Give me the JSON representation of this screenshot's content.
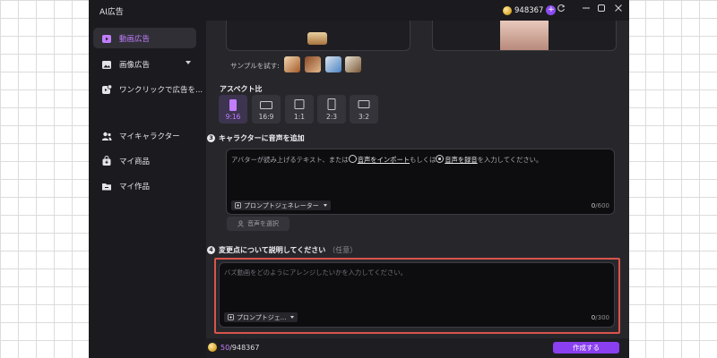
{
  "window": {
    "title": "AI広告",
    "credits": "948367",
    "controls": [
      "refresh-icon",
      "minimize-icon",
      "maximize-icon",
      "close-icon"
    ]
  },
  "sidebar": {
    "items": [
      {
        "label": "動画広告",
        "icon": "video-ad-icon",
        "active": true
      },
      {
        "label": "画像広告",
        "icon": "image-ad-icon",
        "active": false,
        "expandable": true
      },
      {
        "label": "ワンクリックで広告を...",
        "icon": "add-video-icon",
        "active": false
      },
      {
        "label": "マイキャラクター",
        "icon": "characters-icon",
        "active": false
      },
      {
        "label": "マイ商品",
        "icon": "products-icon",
        "active": false
      },
      {
        "label": "マイ作品",
        "icon": "folder-icon",
        "active": false
      }
    ]
  },
  "samples": {
    "label": "サンプルを試す:"
  },
  "aspect": {
    "title": "アスペクト比",
    "selected": "9:16",
    "options": [
      "9:16",
      "16:9",
      "1:1",
      "2:3",
      "3:2"
    ]
  },
  "voice_section": {
    "step": "3",
    "title": "キャラクターに音声を追加",
    "placeholder_pre": "アバターが読み上げるテキスト、または",
    "import_link": "音声をインポート",
    "placeholder_mid": "もしくは",
    "record_link": "音声を録音",
    "placeholder_post": "を入力してください。",
    "generator_label": "プロンプトジェネレーター",
    "counter_current": "0",
    "counter_max": "/600",
    "select_voice": "音声を選択"
  },
  "change_section": {
    "step": "4",
    "title": "変更点について説明してください",
    "optional": "（任意）",
    "placeholder": "バズ動画をどのようにアレンジしたいかを入力してください。",
    "generator_label": "プロンプトジェ...",
    "counter_current": "0",
    "counter_max": "/300"
  },
  "footer": {
    "credits_used": "50",
    "credits_total": "/948367",
    "create_label": "作成する"
  },
  "colors": {
    "accent": "#8a3ff0",
    "accent_text": "#c27dff",
    "highlight": "#d9544b",
    "panel": "#27272b",
    "input_bg": "#0d0d10"
  }
}
